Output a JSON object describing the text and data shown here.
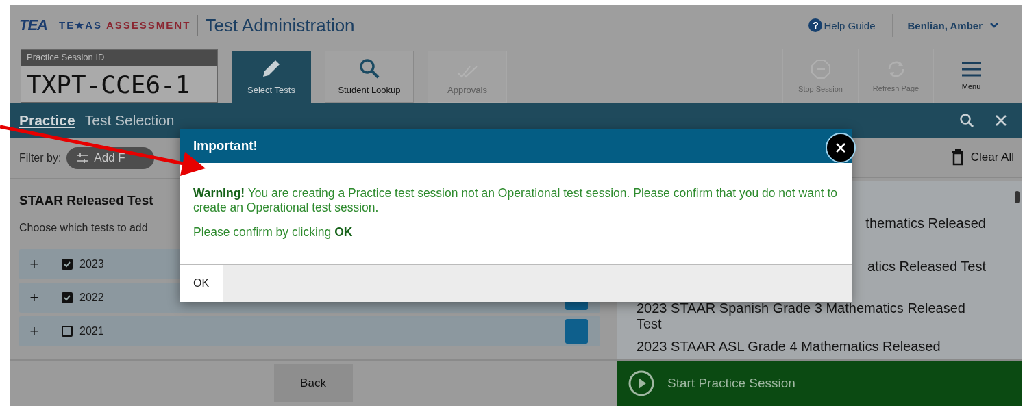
{
  "header": {
    "logo": "TEA",
    "wordmark": [
      "TE★AS",
      "ASSESSMENT"
    ],
    "title": "Test Administration",
    "help_icon": "?",
    "help": "Help Guide",
    "user": "Benlian, Amber"
  },
  "session": {
    "label": "Practice Session ID",
    "id": "TXPT-CCE6-1"
  },
  "tabs": [
    {
      "label": "Select Tests",
      "kind": "edit",
      "selected": true,
      "disabled": false
    },
    {
      "label": "Student Lookup",
      "kind": "lookup",
      "selected": false,
      "disabled": false
    },
    {
      "label": "Approvals",
      "kind": "approve",
      "selected": false,
      "disabled": true
    }
  ],
  "actions": [
    {
      "label": "Stop Session",
      "kind": "stop",
      "disabled": true
    },
    {
      "label": "Refresh Page",
      "kind": "refresh",
      "disabled": true
    },
    {
      "label": "Menu",
      "kind": "menu",
      "disabled": false
    }
  ],
  "breadcrumb": {
    "link": "Practice",
    "title": "Test Selection"
  },
  "filter": {
    "label": "Filter by:",
    "button": "Add F"
  },
  "clear_all": "Clear All",
  "section": {
    "title": "STAAR Released Test",
    "description": "Choose which tests to add"
  },
  "years": [
    {
      "expand": "+",
      "label": "2023",
      "checked": true
    },
    {
      "expand": "+",
      "label": "2022",
      "checked": true
    },
    {
      "expand": "+",
      "label": "2021",
      "checked": false
    }
  ],
  "tests": [
    {
      "text": "thematics Released",
      "clipped": true
    },
    {
      "text": "atics Released Test",
      "clipped": true
    },
    {
      "text": "2023 STAAR Spanish Grade 3 Mathematics Released Test",
      "clipped": false
    },
    {
      "text": "2023 STAAR ASL Grade 4 Mathematics Released",
      "clipped": false
    }
  ],
  "footer": {
    "back": "Back",
    "start": "Start Practice Session"
  },
  "dialog": {
    "title": "Important!",
    "message": "**Warning!** You are creating a Practice test session not an Operational test session. Please confirm that you do not want to create an Operational test session.",
    "confirm": "Please confirm by clicking **OK**",
    "button": "OK"
  }
}
